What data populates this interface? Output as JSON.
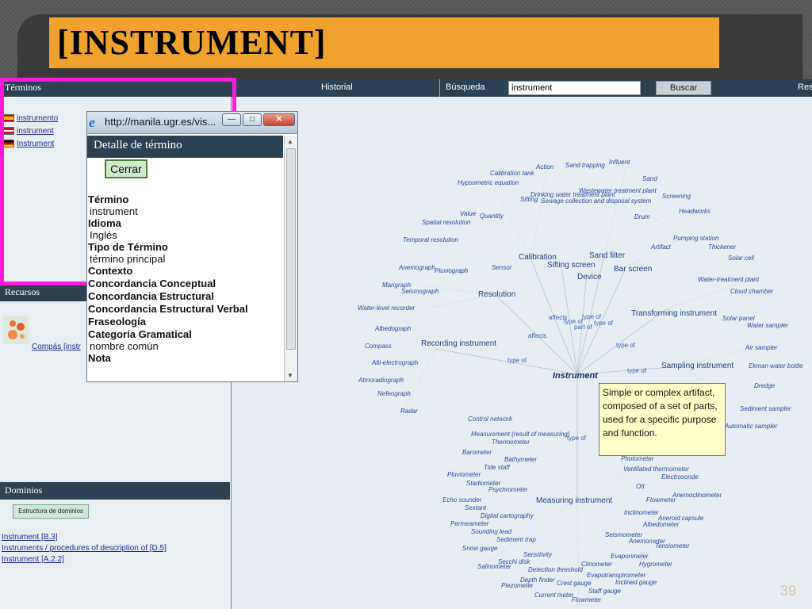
{
  "slide": {
    "title": "[INSTRUMENT]",
    "page_number": "39"
  },
  "topbar": {
    "terms_label": "Términos",
    "history_label": "Historial",
    "search_label": "Búsqueda",
    "search_value": "instrument",
    "search_button": "Buscar",
    "resources_label": "Res"
  },
  "terms": [
    {
      "flag": "es",
      "label": "instrumento"
    },
    {
      "flag": "en",
      "label": "instrument"
    },
    {
      "flag": "de",
      "label": "Instrument"
    }
  ],
  "resources": {
    "header": "Recursos",
    "link": "Compás [instr"
  },
  "domains": {
    "header": "Dominios",
    "button": "Estructura de dominios",
    "links": [
      "Instrument [B.3]",
      "Instruments / procedures of description of [D.5]",
      "Instrument [A.2.2]"
    ]
  },
  "popup": {
    "url": "http://manila.ugr.es/vis...",
    "header": "Detalle de término",
    "close_button": "Cerrar",
    "fields": [
      {
        "label": "Término",
        "value": "instrument"
      },
      {
        "label": "Idioma",
        "value": "Inglés"
      },
      {
        "label": "Tipo de Término",
        "value": "término principal"
      },
      {
        "label": "Contexto",
        "value": ""
      },
      {
        "label": "Concordancia Conceptual",
        "value": ""
      },
      {
        "label": "Concordancia Estructural",
        "value": ""
      },
      {
        "label": "Concordancia Estructural Verbal",
        "value": ""
      },
      {
        "label": "Fraseología",
        "value": ""
      },
      {
        "label": "Categoría Gramatical",
        "value": "nombre común"
      },
      {
        "label": "Nota",
        "value": ""
      }
    ]
  },
  "graph": {
    "center": "Instrument",
    "hubs": [
      "Calibration",
      "Sifting screen",
      "Sand filter",
      "Device",
      "Bar screen",
      "Resolution",
      "Transforming instrument",
      "Recording instrument",
      "Sampling instrument",
      "Measuring instrument"
    ],
    "edges": [
      "affects",
      "type of",
      "type of",
      "part of",
      "type of",
      "affects",
      "type of",
      "type of",
      "type of",
      "type of"
    ],
    "nodes": [
      "Action",
      "Sand trapping",
      "Influent",
      "Calibration tank",
      "Hypsometric equation",
      "Sand",
      "Wastewater treatment plant",
      "Drinking water treatment plant",
      "Sifting",
      "Sewage collection and disposal system",
      "Screening",
      "Value",
      "Quantity",
      "Spatial resolution",
      "Drum",
      "Headworks",
      "Temporal resolution",
      "Pumping station",
      "Artifact",
      "Thickener",
      "Solar cell",
      "Sensor",
      "Anemograph",
      "Pluviograph",
      "Water-treatment plant",
      "Marigraph",
      "Seismograph",
      "Cloud chamber",
      "Water-level recorder",
      "Solar panel",
      "Water sampler",
      "Albedograph",
      "Air sampler",
      "Compass",
      "Ekman water bottle",
      "Alti-electrograph",
      "Dredge",
      "Atmoradiograph",
      "Nefeograph",
      "Sediment sampler",
      "Radar",
      "Automatic sampler",
      "Control network",
      "Measurement (result of measuring)",
      "Thermometer",
      "Barometer",
      "Bathymeter",
      "Photometer",
      "Tide staff",
      "Ventilated thermometer",
      "Pluviometer",
      "Electrosonde",
      "Stadiometer",
      "Psychrometer",
      "Ott",
      "Anemoclinometer",
      "Echo sounder",
      "Flowmeter",
      "Sextant",
      "Inclinometer",
      "Digital cartography",
      "Aneroid capsule",
      "Permeameter",
      "Albedometer",
      "Sounding lead",
      "Seismometer",
      "Sediment trap",
      "Anemometer",
      "Snow gauge",
      "Tensiometer",
      "Sensitivity",
      "Evaporimeter",
      "Secchi disk",
      "Clinometer",
      "Hygrometer",
      "Salinometer",
      "Detection threshold",
      "Evapotranspirometer",
      "Depth finder",
      "Crest gauge",
      "Inclined gauge",
      "Piezometer",
      "Staff gauge",
      "Current meter",
      "Flowmeter"
    ],
    "definition": "Simple or complex artifact, composed of a set of parts, used for a specific purpose  and function."
  }
}
